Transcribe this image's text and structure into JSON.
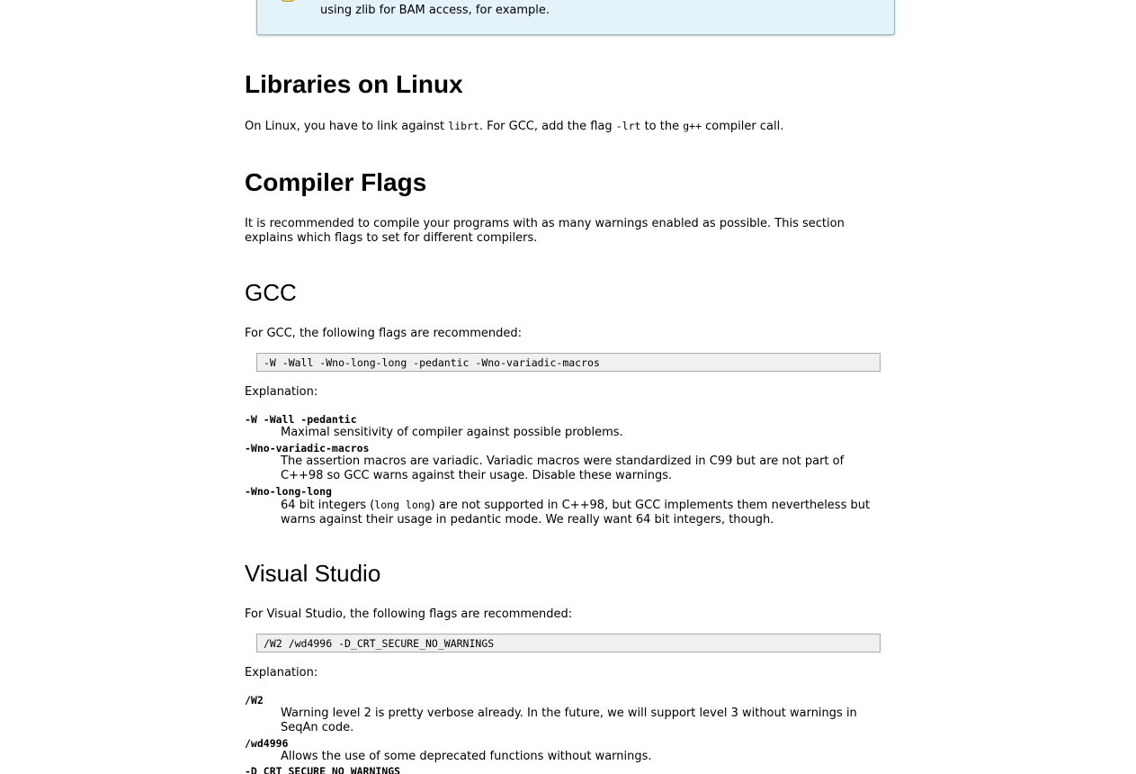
{
  "note": {
    "text": "using zlib for BAM access, for example."
  },
  "libraries": {
    "heading": "Libraries on Linux",
    "p_before_lib": "On Linux, you have to link against ",
    "lib": "librt",
    "p_mid1": ". For GCC, add the flag ",
    "flag": "-lrt",
    "p_mid2": " to the ",
    "compiler": "g++",
    "p_after": " compiler call."
  },
  "compiler_flags": {
    "heading": "Compiler Flags",
    "intro": "It is recommended to compile your programs with as many warnings enabled as possible. This section explains which flags to set for different compilers."
  },
  "gcc": {
    "heading": "GCC",
    "intro": "For GCC, the following flags are recommended:",
    "code": "-W -Wall -Wno-long-long -pedantic -Wno-variadic-macros",
    "explanation_label": "Explanation:",
    "items": [
      {
        "term": "-W -Wall -pedantic",
        "desc": "Maximal sensitivity of compiler against possible problems."
      },
      {
        "term": "-Wno-variadic-macros",
        "desc": "The assertion macros are variadic. Variadic macros were standardized in C99 but are not part of C++98 so GCC warns against their usage. Disable these warnings."
      },
      {
        "term": "-Wno-long-long",
        "desc_before": "64 bit integers (",
        "desc_code": "long long",
        "desc_after": ") are not supported in C++98, but GCC implements them nevertheless but warns against their usage in pedantic mode. We really want 64 bit integers, though."
      }
    ]
  },
  "vs": {
    "heading": "Visual Studio",
    "intro": "For Visual Studio, the following flags are recommended:",
    "code": "/W2 /wd4996 -D_CRT_SECURE_NO_WARNINGS",
    "explanation_label": "Explanation:",
    "items": [
      {
        "term": "/W2",
        "desc": "Warning level 2 is pretty verbose already. In the future, we will support level 3 without warnings in SeqAn code."
      },
      {
        "term": "/wd4996",
        "desc": "Allows the use of some deprecated functions without warnings."
      },
      {
        "term": "-D_CRT_SECURE_NO_WARNINGS",
        "desc": ""
      }
    ]
  }
}
